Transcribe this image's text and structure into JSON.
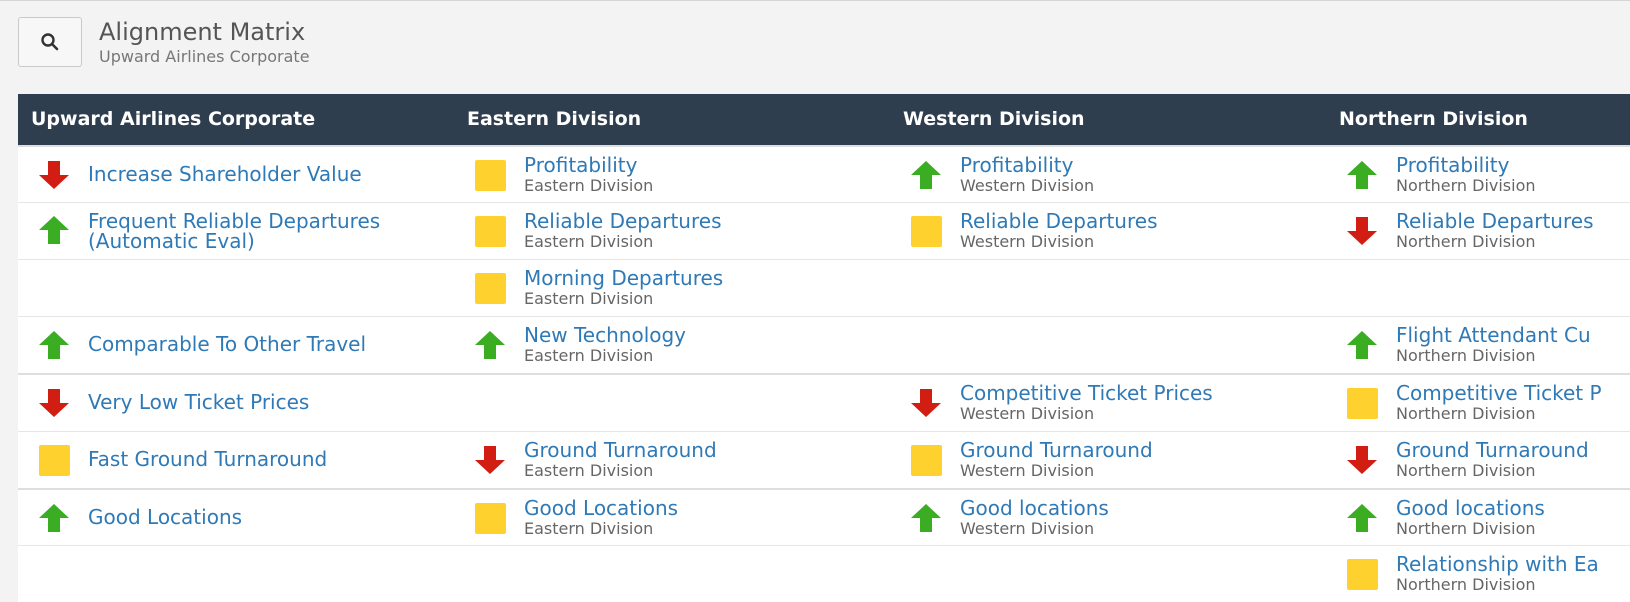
{
  "header": {
    "title": "Alignment Matrix",
    "subtitle": "Upward Airlines Corporate",
    "search_icon": "search-icon"
  },
  "colors": {
    "header_bg": "#2e3e4e",
    "link": "#2f7ab6",
    "up": "#3aad23",
    "down": "#d21d13",
    "neutral": "#ffd12f"
  },
  "columns": [
    {
      "title": "Upward Airlines Corporate",
      "cells": [
        {
          "status": "down",
          "name": "Increase Shareholder Value"
        },
        {
          "status": "up",
          "name": "Frequent Reliable Departures (Automatic Eval)"
        },
        null,
        {
          "status": "up",
          "name": "Comparable To Other Travel"
        },
        {
          "status": "down",
          "name": "Very Low Ticket Prices"
        },
        {
          "status": "neutral",
          "name": "Fast Ground Turnaround"
        },
        {
          "status": "up",
          "name": "Good Locations"
        },
        null
      ]
    },
    {
      "title": "Eastern Division",
      "cells": [
        {
          "status": "neutral",
          "name": "Profitability",
          "division": "Eastern Division"
        },
        {
          "status": "neutral",
          "name": "Reliable Departures",
          "division": "Eastern Division"
        },
        {
          "status": "neutral",
          "name": "Morning Departures",
          "division": "Eastern Division"
        },
        {
          "status": "up",
          "name": "New Technology",
          "division": "Eastern Division"
        },
        null,
        {
          "status": "down",
          "name": "Ground Turnaround",
          "division": "Eastern Division"
        },
        {
          "status": "neutral",
          "name": "Good Locations",
          "division": "Eastern Division"
        },
        null
      ]
    },
    {
      "title": "Western Division",
      "cells": [
        {
          "status": "up",
          "name": "Profitability",
          "division": "Western Division"
        },
        {
          "status": "neutral",
          "name": "Reliable Departures",
          "division": "Western Division"
        },
        null,
        null,
        {
          "status": "down",
          "name": "Competitive Ticket Prices",
          "division": "Western Division"
        },
        {
          "status": "neutral",
          "name": "Ground Turnaround",
          "division": "Western Division"
        },
        {
          "status": "up",
          "name": "Good locations",
          "division": "Western Division"
        },
        null
      ]
    },
    {
      "title": "Northern Division",
      "cells": [
        {
          "status": "up",
          "name": "Profitability",
          "division": "Northern Division"
        },
        {
          "status": "down",
          "name": "Reliable Departures",
          "division": "Northern Division"
        },
        null,
        {
          "status": "up",
          "name": "Flight Attendant Cu",
          "division": "Northern Division"
        },
        {
          "status": "neutral",
          "name": "Competitive Ticket P",
          "division": "Northern Division"
        },
        {
          "status": "down",
          "name": "Ground Turnaround",
          "division": "Northern Division"
        },
        {
          "status": "up",
          "name": "Good locations",
          "division": "Northern Division"
        },
        {
          "status": "neutral",
          "name": "Relationship with Ea",
          "division": "Northern Division"
        }
      ]
    }
  ]
}
